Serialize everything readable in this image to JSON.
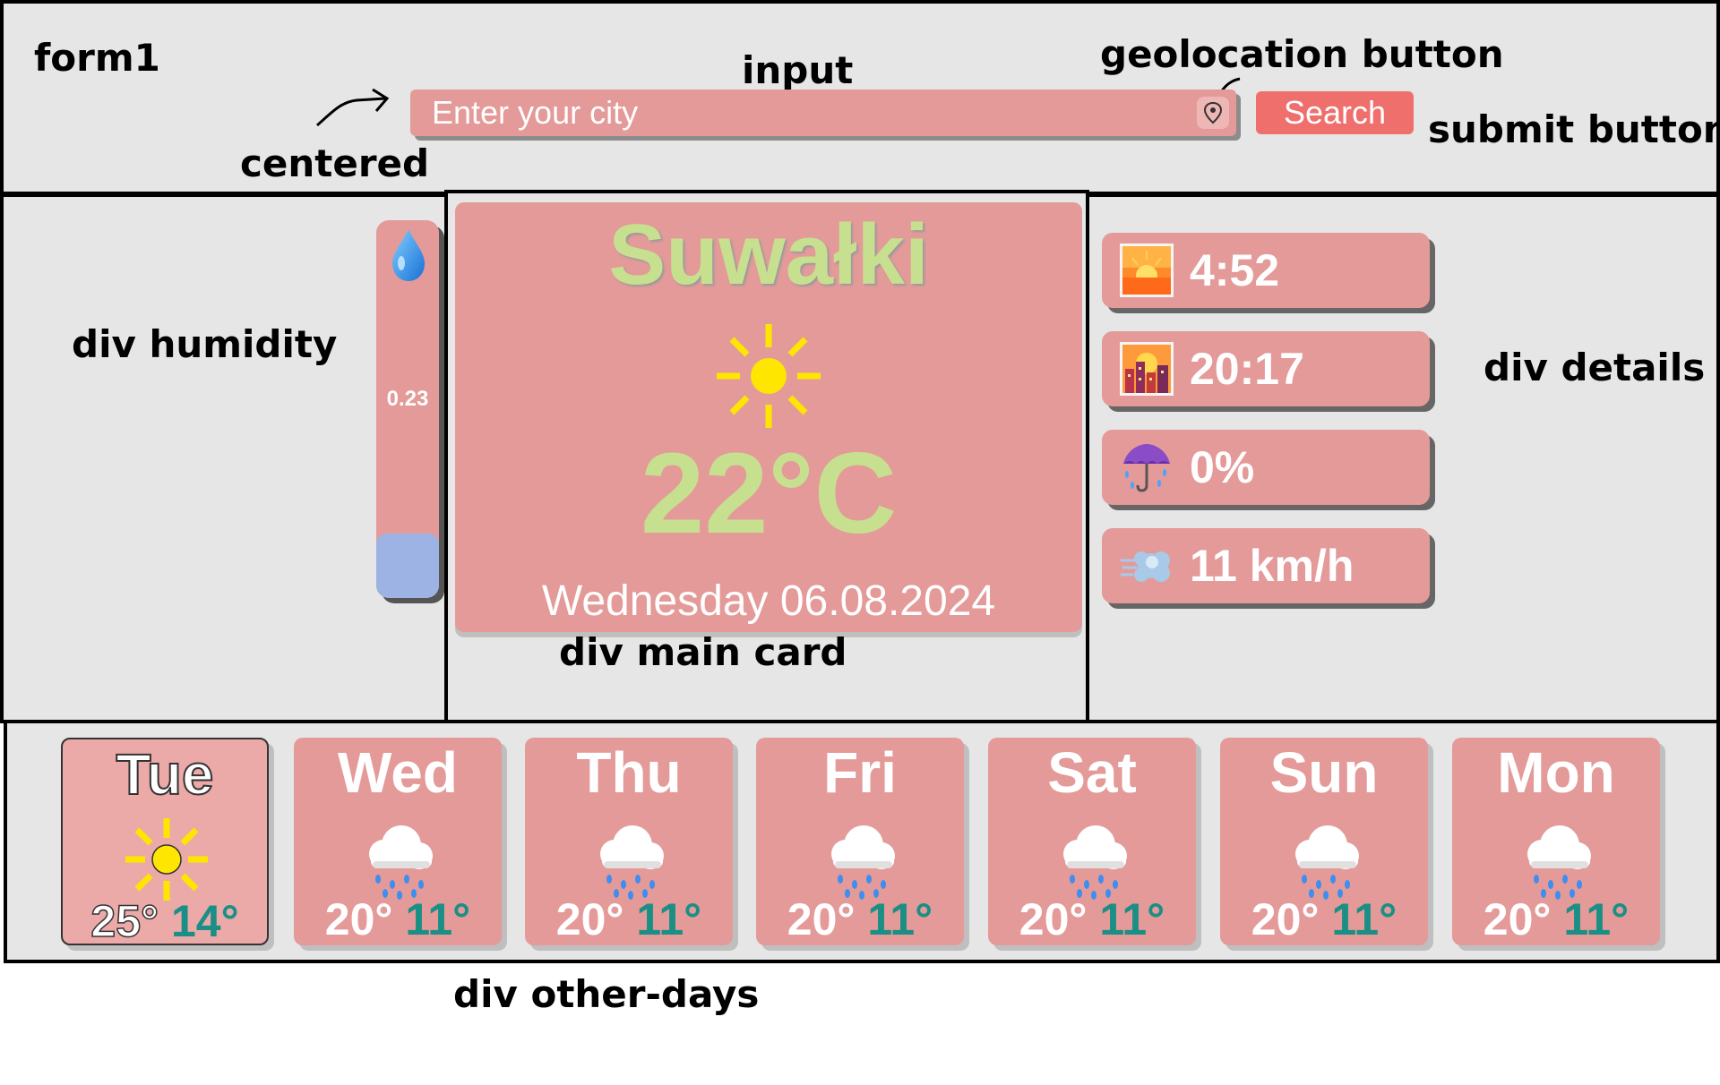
{
  "annotations": {
    "form1": "form1",
    "input": "input",
    "geolocation_button": "geolocation button",
    "centered": "centered",
    "submit_button": "submit button",
    "div_humidity": "div humidity",
    "div_main_card": "div main card",
    "div_details": "div details",
    "div_other_days": "div other-days"
  },
  "form": {
    "city_placeholder": "Enter your city",
    "search_label": "Search",
    "geolocation_icon": "location-pin-icon"
  },
  "humidity": {
    "value_text": "0.23",
    "fill_fraction": 0.17,
    "icon": "droplet-icon"
  },
  "main_card": {
    "city": "Suwałki",
    "temperature": "22°C",
    "date": "Wednesday 06.08.2024",
    "weather_icon": "sun-icon"
  },
  "details": {
    "sunrise": "4:52",
    "sunset": "20:17",
    "precipitation": "0%",
    "wind": "11 km/h",
    "icons": [
      "sunrise-icon",
      "sunset-city-icon",
      "umbrella-rain-icon",
      "wind-icon"
    ]
  },
  "days": [
    {
      "name": "Tue",
      "max": "25°",
      "min": "14°",
      "icon": "sun-icon"
    },
    {
      "name": "Wed",
      "max": "20°",
      "min": "11°",
      "icon": "rain-cloud-icon"
    },
    {
      "name": "Thu",
      "max": "20°",
      "min": "11°",
      "icon": "rain-cloud-icon"
    },
    {
      "name": "Fri",
      "max": "20°",
      "min": "11°",
      "icon": "rain-cloud-icon"
    },
    {
      "name": "Sat",
      "max": "20°",
      "min": "11°",
      "icon": "rain-cloud-icon"
    },
    {
      "name": "Sun",
      "max": "20°",
      "min": "11°",
      "icon": "rain-cloud-icon"
    },
    {
      "name": "Mon",
      "max": "20°",
      "min": "11°",
      "icon": "rain-cloud-icon"
    }
  ],
  "colors": {
    "card": "#e39a98",
    "accent_green": "#c7e08f",
    "min_temp": "#1a8f86",
    "search_button": "#ef6f6c",
    "humidity_fill": "#9db3e4",
    "panel_bg": "#e6e6e6"
  }
}
